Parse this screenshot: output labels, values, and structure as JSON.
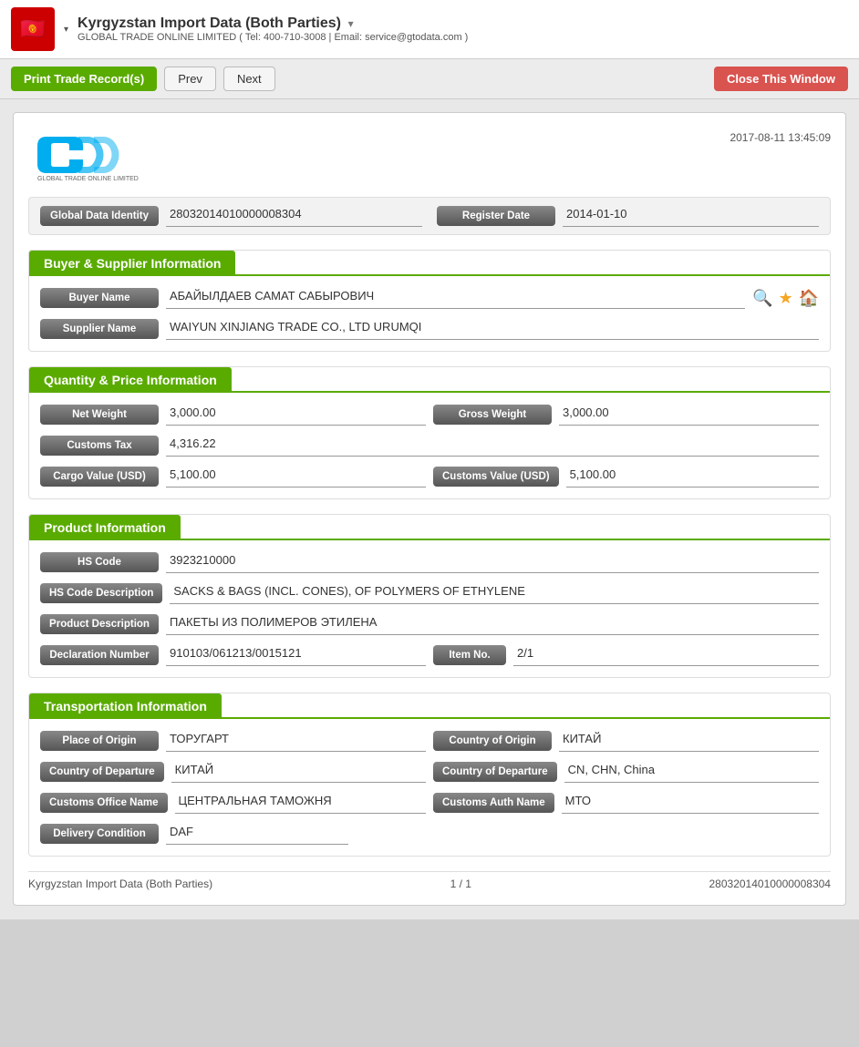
{
  "header": {
    "flag_emoji": "🇰🇬",
    "title": "Kyrgyzstan Import Data (Both Parties)",
    "title_arrow": "▾",
    "subtitle": "GLOBAL TRADE ONLINE LIMITED ( Tel: 400-710-3008 | Email: service@gtodata.com )",
    "dropdown_arrow": "▾"
  },
  "toolbar": {
    "print_label": "Print Trade Record(s)",
    "prev_label": "Prev",
    "next_label": "Next",
    "close_label": "Close This Window"
  },
  "record": {
    "timestamp": "2017-08-11 13:45:09",
    "global_data_identity_label": "Global Data Identity",
    "global_data_identity_value": "28032014010000008304",
    "register_date_label": "Register Date",
    "register_date_value": "2014-01-10",
    "sections": {
      "buyer_supplier": {
        "title": "Buyer & Supplier Information",
        "buyer_name_label": "Buyer Name",
        "buyer_name_value": "АБАЙЫЛДАЕВ САМАТ САБЫРОВИЧ",
        "supplier_name_label": "Supplier Name",
        "supplier_name_value": "WAIYUN XINJIANG TRADE CO., LTD URUMQI"
      },
      "quantity_price": {
        "title": "Quantity & Price Information",
        "net_weight_label": "Net Weight",
        "net_weight_value": "3,000.00",
        "gross_weight_label": "Gross Weight",
        "gross_weight_value": "3,000.00",
        "customs_tax_label": "Customs Tax",
        "customs_tax_value": "4,316.22",
        "cargo_value_label": "Cargo Value (USD)",
        "cargo_value_value": "5,100.00",
        "customs_value_label": "Customs Value (USD)",
        "customs_value_value": "5,100.00"
      },
      "product": {
        "title": "Product Information",
        "hs_code_label": "HS Code",
        "hs_code_value": "3923210000",
        "hs_code_desc_label": "HS Code Description",
        "hs_code_desc_value": "SACKS & BAGS (INCL. CONES), OF POLYMERS OF ETHYLENE",
        "product_desc_label": "Product Description",
        "product_desc_value": "ПАКЕТЫ ИЗ ПОЛИМЕРОВ ЭТИЛЕНА",
        "declaration_number_label": "Declaration Number",
        "declaration_number_value": "910103/061213/0015121",
        "item_no_label": "Item No.",
        "item_no_value": "2/1"
      },
      "transportation": {
        "title": "Transportation Information",
        "place_of_origin_label": "Place of Origin",
        "place_of_origin_value": "ТОРУГАРТ",
        "country_of_origin_label": "Country of Origin",
        "country_of_origin_value": "КИТАЙ",
        "country_of_departure_label": "Country of Departure",
        "country_of_departure_value": "КИТАЙ",
        "country_of_departure2_label": "Country of Departure",
        "country_of_departure2_value": "CN, CHN, China",
        "customs_office_label": "Customs Office Name",
        "customs_office_value": "ЦЕНТРАЛЬНАЯ  ТАМОЖНЯ",
        "customs_auth_label": "Customs Auth Name",
        "customs_auth_value": "МТО",
        "delivery_condition_label": "Delivery Condition",
        "delivery_condition_value": "DAF"
      }
    },
    "footer": {
      "left": "Kyrgyzstan Import Data (Both Parties)",
      "center": "1 / 1",
      "right": "28032014010000008304"
    }
  }
}
